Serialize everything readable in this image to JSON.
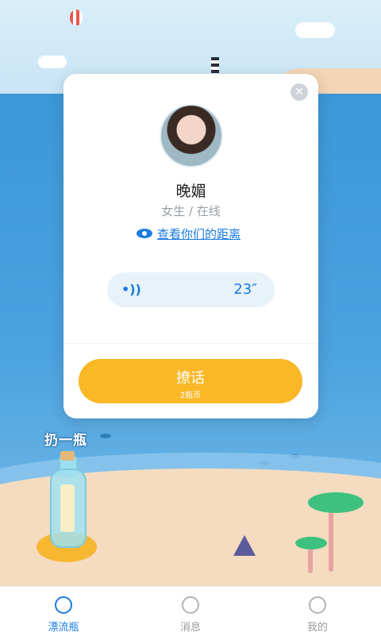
{
  "card": {
    "close_icon": "close-icon",
    "name": "晚媚",
    "meta": "女生 / 在线",
    "distance_link": "查看你们的距离",
    "voice_duration": "23″",
    "chat_button": {
      "label": "撩话",
      "cost": "2瓶币"
    }
  },
  "scene": {
    "throw_label": "扔一瓶"
  },
  "tabs": [
    {
      "label": "漂流瓶",
      "icon": "bottle-icon",
      "active": true
    },
    {
      "label": "消息",
      "icon": "message-icon",
      "active": false
    },
    {
      "label": "我的",
      "icon": "profile-icon",
      "active": false
    }
  ],
  "colors": {
    "accent": "#1a7be0",
    "button": "#fbb826",
    "sea": "#4ba2df"
  }
}
